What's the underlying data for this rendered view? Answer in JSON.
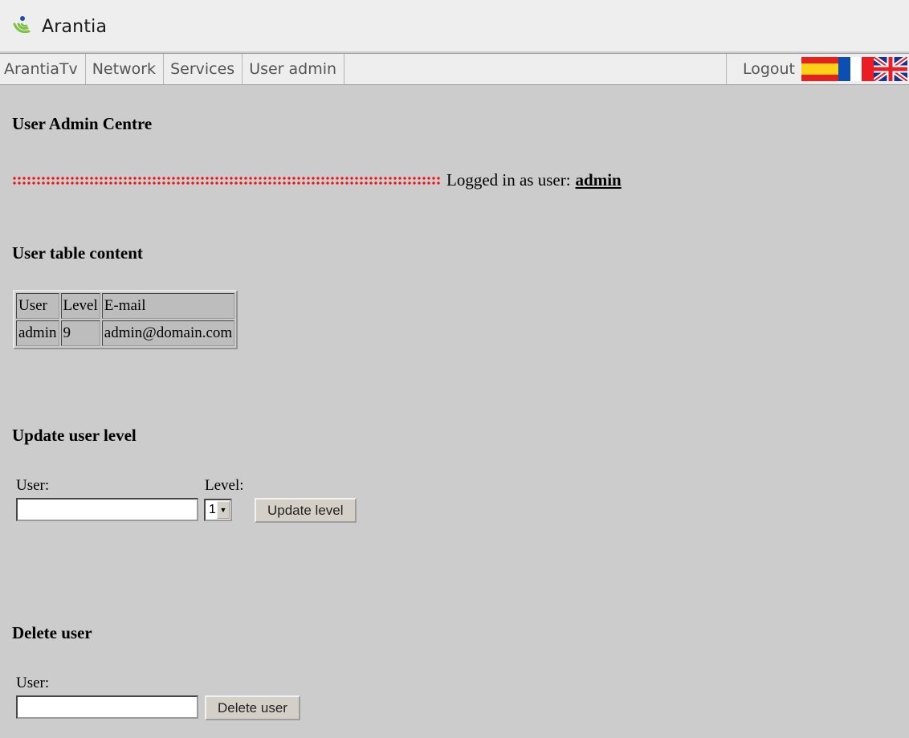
{
  "header": {
    "logo_text": "Arantia"
  },
  "nav": {
    "items": [
      {
        "label": "ArantiaTv"
      },
      {
        "label": "Network"
      },
      {
        "label": "Services"
      },
      {
        "label": "User admin"
      }
    ],
    "logout": "Logout",
    "flags": [
      "spanish-flag-icon",
      "french-flag-icon",
      "uk-flag-icon"
    ]
  },
  "page": {
    "title": "User Admin Centre",
    "logged_in_prefix": "Logged in as user:",
    "logged_in_user": "admin"
  },
  "user_table": {
    "heading": "User table content",
    "columns": [
      "User",
      "Level",
      "E-mail"
    ],
    "rows": [
      [
        "admin",
        "9",
        "admin@domain.com"
      ]
    ]
  },
  "update_level": {
    "heading": "Update user level",
    "user_label": "User:",
    "user_value": "",
    "level_label": "Level:",
    "level_value": "1",
    "button": "Update level"
  },
  "delete_user": {
    "heading": "Delete user",
    "user_label": "User:",
    "user_value": "",
    "button": "Delete user"
  },
  "colors": {
    "background": "#cccccc",
    "bar": "#eeeeee",
    "dots": "#ee1111"
  }
}
